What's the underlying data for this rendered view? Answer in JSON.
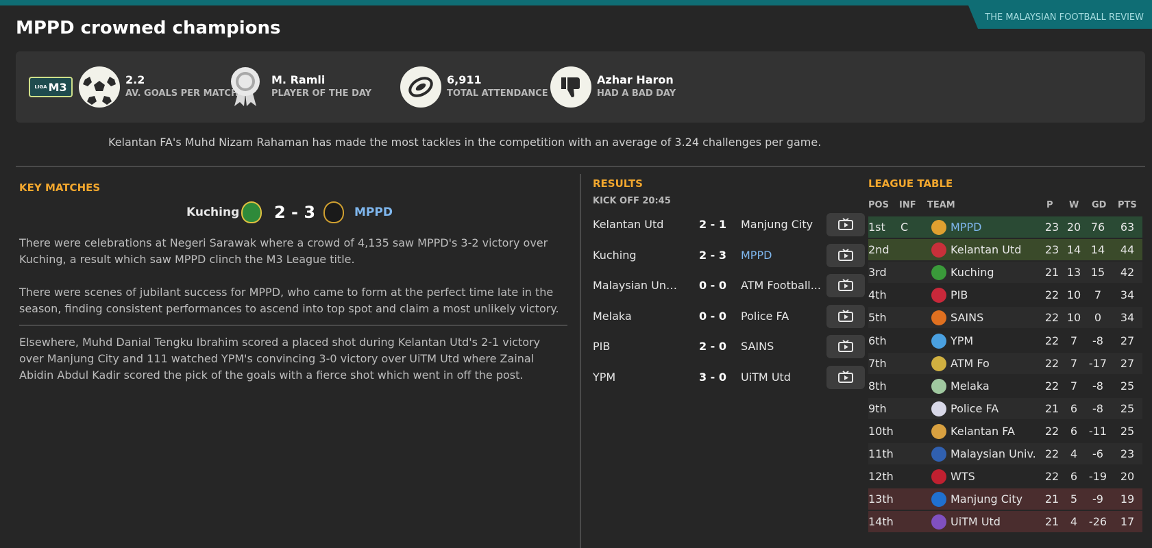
{
  "brand": "THE MALAYSIAN FOOTBALL REVIEW",
  "title": "MPPD crowned champions",
  "league_logo": {
    "prefix": "LIGA",
    "name": "M3"
  },
  "stats": [
    {
      "value": "2.2",
      "label": "AV. GOALS PER MATCH",
      "icon": "football-icon"
    },
    {
      "value": "M. Ramli",
      "label": "PLAYER OF THE DAY",
      "icon": "award-rosette-icon"
    },
    {
      "value": "6,911",
      "label": "TOTAL ATTENDANCE",
      "icon": "stadium-icon"
    },
    {
      "value": "Azhar Haron",
      "label": "HAD A BAD DAY",
      "icon": "thumbs-down-icon"
    }
  ],
  "fact": "Kelantan FA's Muhd Nizam Rahaman has made the most tackles in the competition with an average of 3.24 challenges per game.",
  "key_matches": {
    "title": "KEY MATCHES",
    "home": "Kuching",
    "score": "2 - 3",
    "away": "MPPD",
    "paragraphs": [
      "There were celebrations at Negeri Sarawak where a crowd of 4,135 saw MPPD's 3-2 victory over Kuching, a result which saw MPPD clinch the M3 League title.",
      "There were scenes of jubilant success for MPPD, who came to form at the perfect time late in the season, finding consistent performances to ascend into top spot and claim a most unlikely victory.",
      "Elsewhere, Muhd Danial Tengku Ibrahim scored a placed shot during Kelantan Utd's 2-1 victory over Manjung City and 111 watched YPM's convincing 3-0 victory over UiTM Utd where Zainal Abidin Abdul Kadir scored the pick of the goals with a fierce shot which went in off the post."
    ]
  },
  "results": {
    "title": "RESULTS",
    "kickoff": "KICK OFF 20:45",
    "rows": [
      {
        "home": "Kelantan Utd",
        "score": "2 - 1",
        "away": "Manjung City"
      },
      {
        "home": "Kuching",
        "score": "2 - 3",
        "away": "MPPD"
      },
      {
        "home": "Malaysian Uni...",
        "score": "0 - 0",
        "away": "ATM Football..."
      },
      {
        "home": "Melaka",
        "score": "0 - 0",
        "away": "Police FA"
      },
      {
        "home": "PIB",
        "score": "2 - 0",
        "away": "SAINS"
      },
      {
        "home": "YPM",
        "score": "3 - 0",
        "away": "UiTM Utd"
      }
    ]
  },
  "league_table": {
    "title": "LEAGUE TABLE",
    "headers": {
      "pos": "POS",
      "inf": "INF",
      "team": "TEAM",
      "p": "P",
      "w": "W",
      "gd": "GD",
      "pts": "PTS"
    },
    "rows": [
      {
        "pos": "1st",
        "inf": "C",
        "team": "MPPD",
        "p": "23",
        "w": "20",
        "gd": "76",
        "pts": "63",
        "crest": "#e0a030"
      },
      {
        "pos": "2nd",
        "inf": "",
        "team": "Kelantan Utd",
        "p": "23",
        "w": "14",
        "gd": "14",
        "pts": "44",
        "crest": "#c8303a"
      },
      {
        "pos": "3rd",
        "inf": "",
        "team": "Kuching",
        "p": "21",
        "w": "13",
        "gd": "15",
        "pts": "42",
        "crest": "#3a9a3a"
      },
      {
        "pos": "4th",
        "inf": "",
        "team": "PIB",
        "p": "22",
        "w": "10",
        "gd": "7",
        "pts": "34",
        "crest": "#c8283a"
      },
      {
        "pos": "5th",
        "inf": "",
        "team": "SAINS",
        "p": "22",
        "w": "10",
        "gd": "0",
        "pts": "34",
        "crest": "#e07020"
      },
      {
        "pos": "6th",
        "inf": "",
        "team": "YPM",
        "p": "22",
        "w": "7",
        "gd": "-8",
        "pts": "27",
        "crest": "#4aa0e0"
      },
      {
        "pos": "7th",
        "inf": "",
        "team": "ATM Fo",
        "p": "22",
        "w": "7",
        "gd": "-17",
        "pts": "27",
        "crest": "#d0b040"
      },
      {
        "pos": "8th",
        "inf": "",
        "team": "Melaka",
        "p": "22",
        "w": "7",
        "gd": "-8",
        "pts": "25",
        "crest": "#a0c8a0"
      },
      {
        "pos": "9th",
        "inf": "",
        "team": "Police FA",
        "p": "21",
        "w": "6",
        "gd": "-8",
        "pts": "25",
        "crest": "#d8d8e8"
      },
      {
        "pos": "10th",
        "inf": "",
        "team": "Kelantan FA",
        "p": "22",
        "w": "6",
        "gd": "-11",
        "pts": "25",
        "crest": "#d8a040"
      },
      {
        "pos": "11th",
        "inf": "",
        "team": "Malaysian Univ.",
        "p": "22",
        "w": "4",
        "gd": "-6",
        "pts": "23",
        "crest": "#3060b0"
      },
      {
        "pos": "12th",
        "inf": "",
        "team": "WTS",
        "p": "22",
        "w": "6",
        "gd": "-19",
        "pts": "20",
        "crest": "#c02030"
      },
      {
        "pos": "13th",
        "inf": "",
        "team": "Manjung City",
        "p": "21",
        "w": "5",
        "gd": "-9",
        "pts": "19",
        "crest": "#2070d0"
      },
      {
        "pos": "14th",
        "inf": "",
        "team": "UiTM Utd",
        "p": "21",
        "w": "4",
        "gd": "-26",
        "pts": "17",
        "crest": "#8050c0"
      }
    ]
  },
  "colors": {
    "accent": "#0f6d74",
    "section_title": "#f2a72e",
    "highlight_team": "#7fb7ee"
  }
}
